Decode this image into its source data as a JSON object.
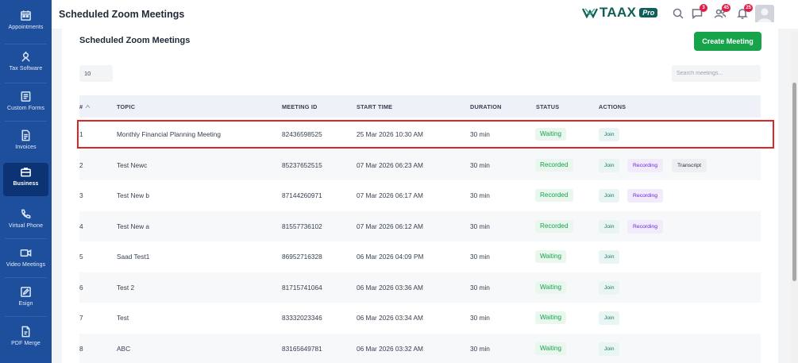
{
  "sidebar": {
    "items": [
      {
        "label": "Appointments",
        "icon": "calendar-icon"
      },
      {
        "label": "Tax Software",
        "icon": "tax-icon"
      },
      {
        "label": "Custom Forms",
        "icon": "form-icon"
      },
      {
        "label": "Invoices",
        "icon": "invoice-icon"
      },
      {
        "label": "Business",
        "icon": "briefcase-icon"
      },
      {
        "label": "Virtual Phone",
        "icon": "phone-icon"
      },
      {
        "label": "Video Meetings",
        "icon": "video-icon"
      },
      {
        "label": "Esign",
        "icon": "pen-icon"
      },
      {
        "label": "PDF Merge",
        "icon": "pdf-icon"
      }
    ],
    "active": "Business"
  },
  "header": {
    "title": "Scheduled Zoom Meetings",
    "logo_text": "TAAX",
    "logo_badge": "Pro",
    "notifications": [
      {
        "icon": "chat-icon",
        "count": "3"
      },
      {
        "icon": "users-icon",
        "count": "45"
      },
      {
        "icon": "bell-icon",
        "count": "25"
      }
    ]
  },
  "main": {
    "title": "Scheduled Zoom Meetings",
    "create_button": "Create Meeting",
    "page_size": "10",
    "search_placeholder": "Search meetings...",
    "columns": {
      "num": "#",
      "topic": "TOPIC",
      "meeting_id": "MEETING ID",
      "start_time": "START TIME",
      "duration": "DURATION",
      "status": "STATUS",
      "actions": "ACTIONS"
    },
    "rows": [
      {
        "num": "1",
        "topic": "Monthly Financial Planning Meeting",
        "meeting_id": "82436598525",
        "start_time": "25 Mar 2026 10:30 AM",
        "duration": "30 min",
        "status": "Waiting",
        "actions": [
          "Join"
        ]
      },
      {
        "num": "2",
        "topic": "Test Newc",
        "meeting_id": "85237652515",
        "start_time": "07 Mar 2026 06:23 AM",
        "duration": "30 min",
        "status": "Recorded",
        "actions": [
          "Join",
          "Recording",
          "Transcript"
        ]
      },
      {
        "num": "3",
        "topic": "Test New b",
        "meeting_id": "87144260971",
        "start_time": "07 Mar 2026 06:17 AM",
        "duration": "30 min",
        "status": "Recorded",
        "actions": [
          "Join",
          "Recording"
        ]
      },
      {
        "num": "4",
        "topic": "Test New a",
        "meeting_id": "81557736102",
        "start_time": "07 Mar 2026 06:12 AM",
        "duration": "30 min",
        "status": "Recorded",
        "actions": [
          "Join",
          "Recording"
        ]
      },
      {
        "num": "5",
        "topic": "Saad Test1",
        "meeting_id": "86952716328",
        "start_time": "06 Mar 2026 04:09 PM",
        "duration": "30 min",
        "status": "Waiting",
        "actions": [
          "Join"
        ]
      },
      {
        "num": "6",
        "topic": "Test 2",
        "meeting_id": "81715741064",
        "start_time": "06 Mar 2026 03:36 AM",
        "duration": "30 min",
        "status": "Waiting",
        "actions": [
          "Join"
        ]
      },
      {
        "num": "7",
        "topic": "Test",
        "meeting_id": "83332023346",
        "start_time": "06 Mar 2026 03:34 AM",
        "duration": "30 min",
        "status": "Waiting",
        "actions": [
          "Join"
        ]
      },
      {
        "num": "8",
        "topic": "ABC",
        "meeting_id": "83165649781",
        "start_time": "06 Mar 2026 03:32 AM",
        "duration": "30 min",
        "status": "Waiting",
        "actions": [
          "Join"
        ]
      }
    ]
  },
  "colors": {
    "sidebar_bg": "#1d4f9c",
    "sidebar_active": "#0c3474",
    "primary_green": "#16a34a",
    "highlight_border": "#dc2626",
    "brand": "#0f5e57"
  }
}
